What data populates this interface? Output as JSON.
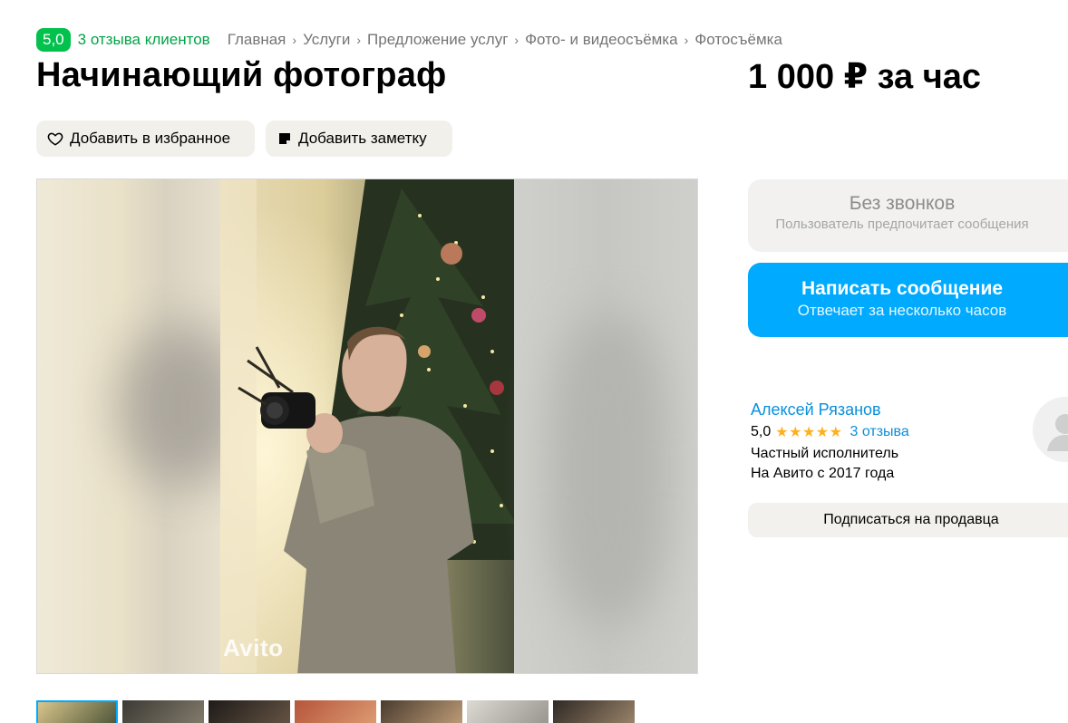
{
  "header": {
    "rating_badge": "5,0",
    "reviews_link": "3 отзыва клиентов",
    "breadcrumb": [
      "Главная",
      "Услуги",
      "Предложение услуг",
      "Фото- и видеосъёмка",
      "Фотосъёмка"
    ],
    "breadcrumb_separator": "›"
  },
  "listing": {
    "title": "Начинающий фотограф",
    "price": "1 000 ₽ за час"
  },
  "actions": {
    "favorite_label": "Добавить в избранное",
    "note_label": "Добавить заметку"
  },
  "gallery": {
    "watermark": "Avito",
    "thumbnail_count": 7,
    "active_thumbnail": 1
  },
  "contact": {
    "no_calls_title": "Без звонков",
    "no_calls_subtitle": "Пользователь предпочитает сообщения",
    "message_title": "Написать сообщение",
    "message_subtitle": "Отвечает за несколько часов"
  },
  "seller": {
    "name": "Алексей Рязанов",
    "rating": "5,0",
    "stars": "★★★★★",
    "reviews": "3 отзыва",
    "type": "Частный исполнитель",
    "since": "На Авито с 2017 года",
    "subscribe_label": "Подписаться на продавца"
  },
  "colors": {
    "accent_green": "#02c14d",
    "link_green": "#02a346",
    "primary_blue": "#00aaff",
    "link_blue": "#0a8fdc",
    "star": "#ffb021",
    "button_beige": "#f2f0eb"
  }
}
